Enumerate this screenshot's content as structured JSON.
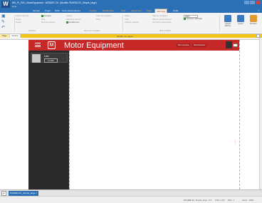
{
  "window": {
    "title": "WS_PI_SGC_MotorEquipment - WEBDEV 26 - [Modèle PAGEBLOC_Simple_large]",
    "quick_access": "◈ ⊞",
    "controls": [
      "",
      "",
      ""
    ]
  },
  "menu": {
    "tabs": [
      "Accueil",
      "Projet",
      "SCM",
      "Tests automatiques",
      "Création",
      "Modification",
      "Style",
      "Alignement",
      "Page",
      "Affichage",
      "Outils"
    ],
    "active_tab": "Affichage"
  },
  "ribbon": {
    "col1": [
      "Grilles d'ancrage",
      "Règles",
      "Guides"
    ],
    "col2": [
      "Ancrages",
      "Note",
      "Bord des groupes"
    ],
    "col3": [
      "Largeur",
      "Saisie des champs",
      "Encadrement"
    ],
    "col3_checked": [
      true,
      false,
      true
    ],
    "col4": [
      "Ordre de navigation",
      "Plans"
    ],
    "col5": [
      "Règles",
      "Grille",
      "Champs masqués"
    ],
    "col6": [
      "Taille de navigation",
      "Taille de positionnement",
      "Format de superposition"
    ],
    "zoom": "100%",
    "option_label": "Optimiser l'affichage",
    "group_labels": [
      "Fenêtres",
      "Aide à la conception",
      "Aide à l'édition"
    ],
    "big_buttons": [
      "Largeur affichée",
      "Ajuster",
      "Recadrer"
    ],
    "help_label": "?"
  },
  "doc_tabs": [
    "Page",
    "Source"
  ],
  "context_label": "Modèle de pages",
  "app": {
    "title": "Motor Equipment",
    "header_buttons": [
      "Mon compte",
      "Déconnexion"
    ],
    "avatar_tag": "",
    "user_name": "Lion",
    "logout_label": "Lovelé"
  },
  "side_marker": "⋮",
  "page_tab": "PAGEBLOC_Simple_large ×",
  "status": {
    "left": "PAGEBLOC_Simple_large : 0,0",
    "mid": "1316 x 317",
    "right": "Plan : 1",
    "zoom": "Zoom : 100%"
  }
}
